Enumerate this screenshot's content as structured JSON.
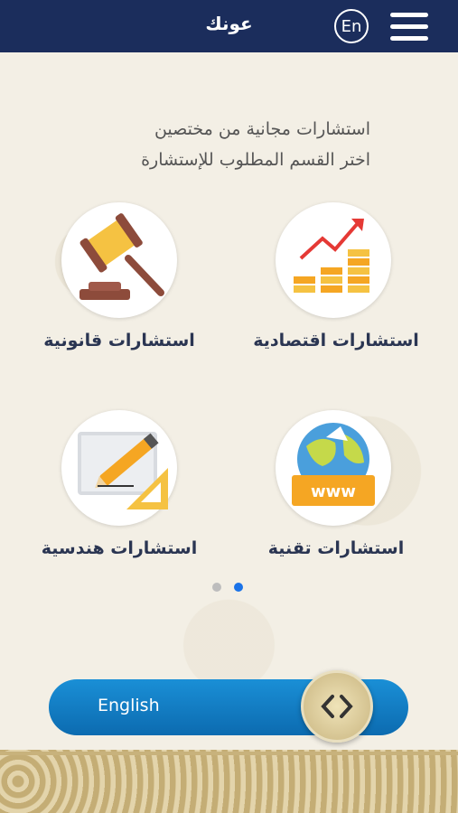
{
  "header": {
    "app_title": "عونك",
    "language_button": "En",
    "menu_icon": "hamburger-menu-icon"
  },
  "intro": {
    "line1": "استشارات مجانية من مختصين",
    "line2": "اختر القسم المطلوب للإستشارة"
  },
  "categories": [
    {
      "label": "استشارات اقتصادية",
      "icon": "growth-chart-coins-icon"
    },
    {
      "label": "استشارات قانونية",
      "icon": "gavel-icon"
    },
    {
      "label": "استشارات تقنية",
      "icon": "globe-www-icon"
    },
    {
      "label": "استشارات هندسية",
      "icon": "blueprint-pencil-icon"
    }
  ],
  "pagination": {
    "pages": 2,
    "active_page": 2
  },
  "language_toggle": {
    "label": "English",
    "knob_icon": "code-brackets-icon"
  },
  "colors": {
    "header_bg": "#1b2d5c",
    "toggle_bg": "#0c6bb0",
    "dot_active": "#1a73e8",
    "dot_inactive": "#bdbdbd"
  }
}
